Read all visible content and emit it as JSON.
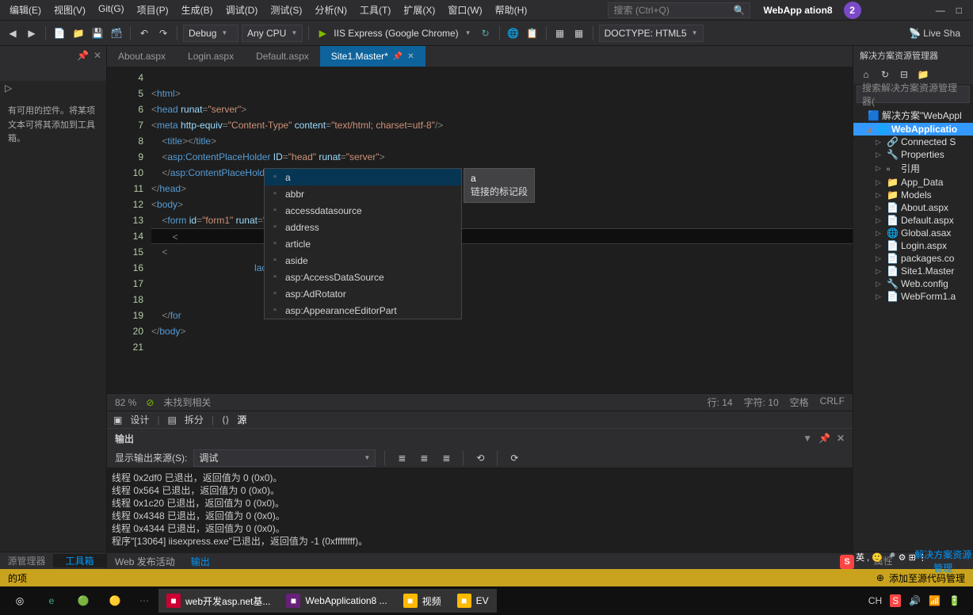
{
  "menu": [
    "编辑(E)",
    "视图(V)",
    "Git(G)",
    "项目(P)",
    "生成(B)",
    "调试(D)",
    "测试(S)",
    "分析(N)",
    "工具(T)",
    "扩展(X)",
    "窗口(W)",
    "帮助(H)"
  ],
  "search_placeholder": "搜索 (Ctrl+Q)",
  "solution_title": "WebApp        ation8",
  "badge": "2",
  "toolbar": {
    "config": "Debug",
    "platform": "Any CPU",
    "run": "IIS Express (Google Chrome)",
    "doctype": "DOCTYPE: HTML5",
    "liveshare": "Live Sha"
  },
  "tabs": [
    {
      "label": "About.aspx",
      "active": false
    },
    {
      "label": "Login.aspx",
      "active": false
    },
    {
      "label": "Default.aspx",
      "active": false
    },
    {
      "label": "Site1.Master*",
      "active": true
    }
  ],
  "left": {
    "body": "有可用的控件。将某项文本可将其添加到工具箱。",
    "tabs": [
      "源管理器",
      "工具箱"
    ]
  },
  "code": {
    "start": 4,
    "lines": [
      {
        "n": 4,
        "html": ""
      },
      {
        "n": 5,
        "html": "<span class='t-punc'>&lt;</span><span class='t-tag'>html</span><span class='t-punc'>&gt;</span>"
      },
      {
        "n": 6,
        "html": "<span class='t-punc'>&lt;</span><span class='t-tag'>head</span> <span class='t-attr'>runat</span><span class='t-punc'>=</span><span class='t-str'>&quot;server&quot;</span><span class='t-punc'>&gt;</span>"
      },
      {
        "n": 7,
        "html": "<span class='t-punc'>&lt;</span><span class='t-tag'>meta</span> <span class='t-attr'>http-equiv</span><span class='t-punc'>=</span><span class='t-str'>&quot;Content-Type&quot;</span> <span class='t-attr'>content</span><span class='t-punc'>=</span><span class='t-str'>&quot;text/html; charset=utf-8&quot;</span><span class='t-punc'>/&gt;</span>"
      },
      {
        "n": 8,
        "html": "    <span class='t-punc'>&lt;</span><span class='t-tag'>title</span><span class='t-punc'>&gt;&lt;/</span><span class='t-tag'>title</span><span class='t-punc'>&gt;</span>"
      },
      {
        "n": 9,
        "html": "    <span class='t-punc'>&lt;</span><span class='t-tag'>asp:ContentPlaceHolder</span> <span class='t-attr'>ID</span><span class='t-punc'>=</span><span class='t-str'>&quot;head&quot;</span> <span class='t-attr'>runat</span><span class='t-punc'>=</span><span class='t-str'>&quot;server&quot;</span><span class='t-punc'>&gt;</span>"
      },
      {
        "n": 10,
        "html": "    <span class='t-punc'>&lt;/</span><span class='t-tag'>asp:ContentPlaceHolder</span><span class='t-punc'>&gt;</span>"
      },
      {
        "n": 11,
        "html": "<span class='t-punc'>&lt;/</span><span class='t-tag'>head</span><span class='t-punc'>&gt;</span>"
      },
      {
        "n": 12,
        "html": "<span class='t-punc'>&lt;</span><span class='t-tag'>body</span><span class='t-punc'>&gt;</span>"
      },
      {
        "n": 13,
        "html": "    <span class='t-punc'>&lt;</span><span class='t-tag'>form</span> <span class='t-attr'>id</span><span class='t-punc'>=</span><span class='t-str'>&quot;form1&quot;</span> <span class='t-attr'>runat</span><span class='t-punc'>=</span><span class='t-str'>&quot;server&quot;</span><span class='t-punc'>&gt;</span>   <span style='color:#ccc'>|</span>"
      },
      {
        "n": 14,
        "html": "        <span class='t-punc'>&lt;</span>",
        "current": true
      },
      {
        "n": 15,
        "html": "    <span class='t-punc'>&lt;</span>"
      },
      {
        "n": 16,
        "html": "                                       <span class='t-tag'>laceHolder1</span><span class='t-str'>&quot;</span> <span class='t-attr'>runat</span><span class='t-punc'>=</span><span class='t-str'>&quot;server&quot;</span><span class='t-punc'>&gt;</span>"
      },
      {
        "n": 17,
        "html": ""
      },
      {
        "n": 18,
        "html": "        "
      },
      {
        "n": 19,
        "html": "    <span class='t-punc'>&lt;/</span><span class='t-tag'>for</span>"
      },
      {
        "n": 20,
        "html": "<span class='t-punc'>&lt;/</span><span class='t-tag'>body</span><span class='t-punc'>&gt;</span>"
      },
      {
        "n": 21,
        "html": ""
      }
    ]
  },
  "intellisense": {
    "items": [
      "a",
      "abbr",
      "accessdatasource",
      "address",
      "article",
      "aside",
      "asp:AccessDataSource",
      "asp:AdRotator",
      "asp:AppearanceEditorPart"
    ],
    "selected": 0,
    "tooltip_title": "a",
    "tooltip_desc": "链接的标记段"
  },
  "status": {
    "zoom": "82 %",
    "issue": "未找到相关",
    "ln": "行: 14",
    "col": "字符: 10",
    "spc": "空格",
    "enc": "CRLF"
  },
  "designbar": [
    "设计",
    "拆分",
    "源"
  ],
  "output": {
    "title": "输出",
    "source_label": "显示输出来源(S):",
    "source_value": "调试",
    "lines": [
      "线程 0x2df0 已退出，返回值为 0 (0x0)。",
      "线程 0x564 已退出，返回值为 0 (0x0)。",
      "线程 0x1c20 已退出，返回值为 0 (0x0)。",
      "线程 0x4348 已退出，返回值为 0 (0x0)。",
      "线程 0x4344 已退出，返回值为 0 (0x0)。",
      "程序\"[13064] iisexpress.exe\"已退出，返回值为 -1 (0xffffffff)。"
    ],
    "tabs": [
      "Web 发布活动",
      "输出"
    ]
  },
  "solution": {
    "title": "解决方案资源管理器",
    "search": "搜索解决方案资源管理器(",
    "root": "解决方案\"WebAppl",
    "project": "WebApplicatio",
    "items": [
      "Connected S",
      "Properties",
      "引用",
      "App_Data",
      "Models",
      "About.aspx",
      "Default.aspx",
      "Global.asax",
      "Login.aspx",
      "packages.co",
      "Site1.Master",
      "Web.config",
      "WebForm1.a"
    ],
    "footer": [
      "属性",
      "解决方案资源管理"
    ]
  },
  "yellow": {
    "left": "的项",
    "right": "添加至源代码管理"
  },
  "taskbar": {
    "items": [
      {
        "label": "",
        "color": "#fff"
      },
      {
        "label": "web开发asp.net基...",
        "color": "#c03"
      },
      {
        "label": "WebApplication8 ...",
        "color": "#68217a"
      },
      {
        "label": "视频",
        "color": "#ffb900"
      },
      {
        "label": "EV",
        "color": "#ffb900"
      }
    ],
    "tray": "CH"
  }
}
